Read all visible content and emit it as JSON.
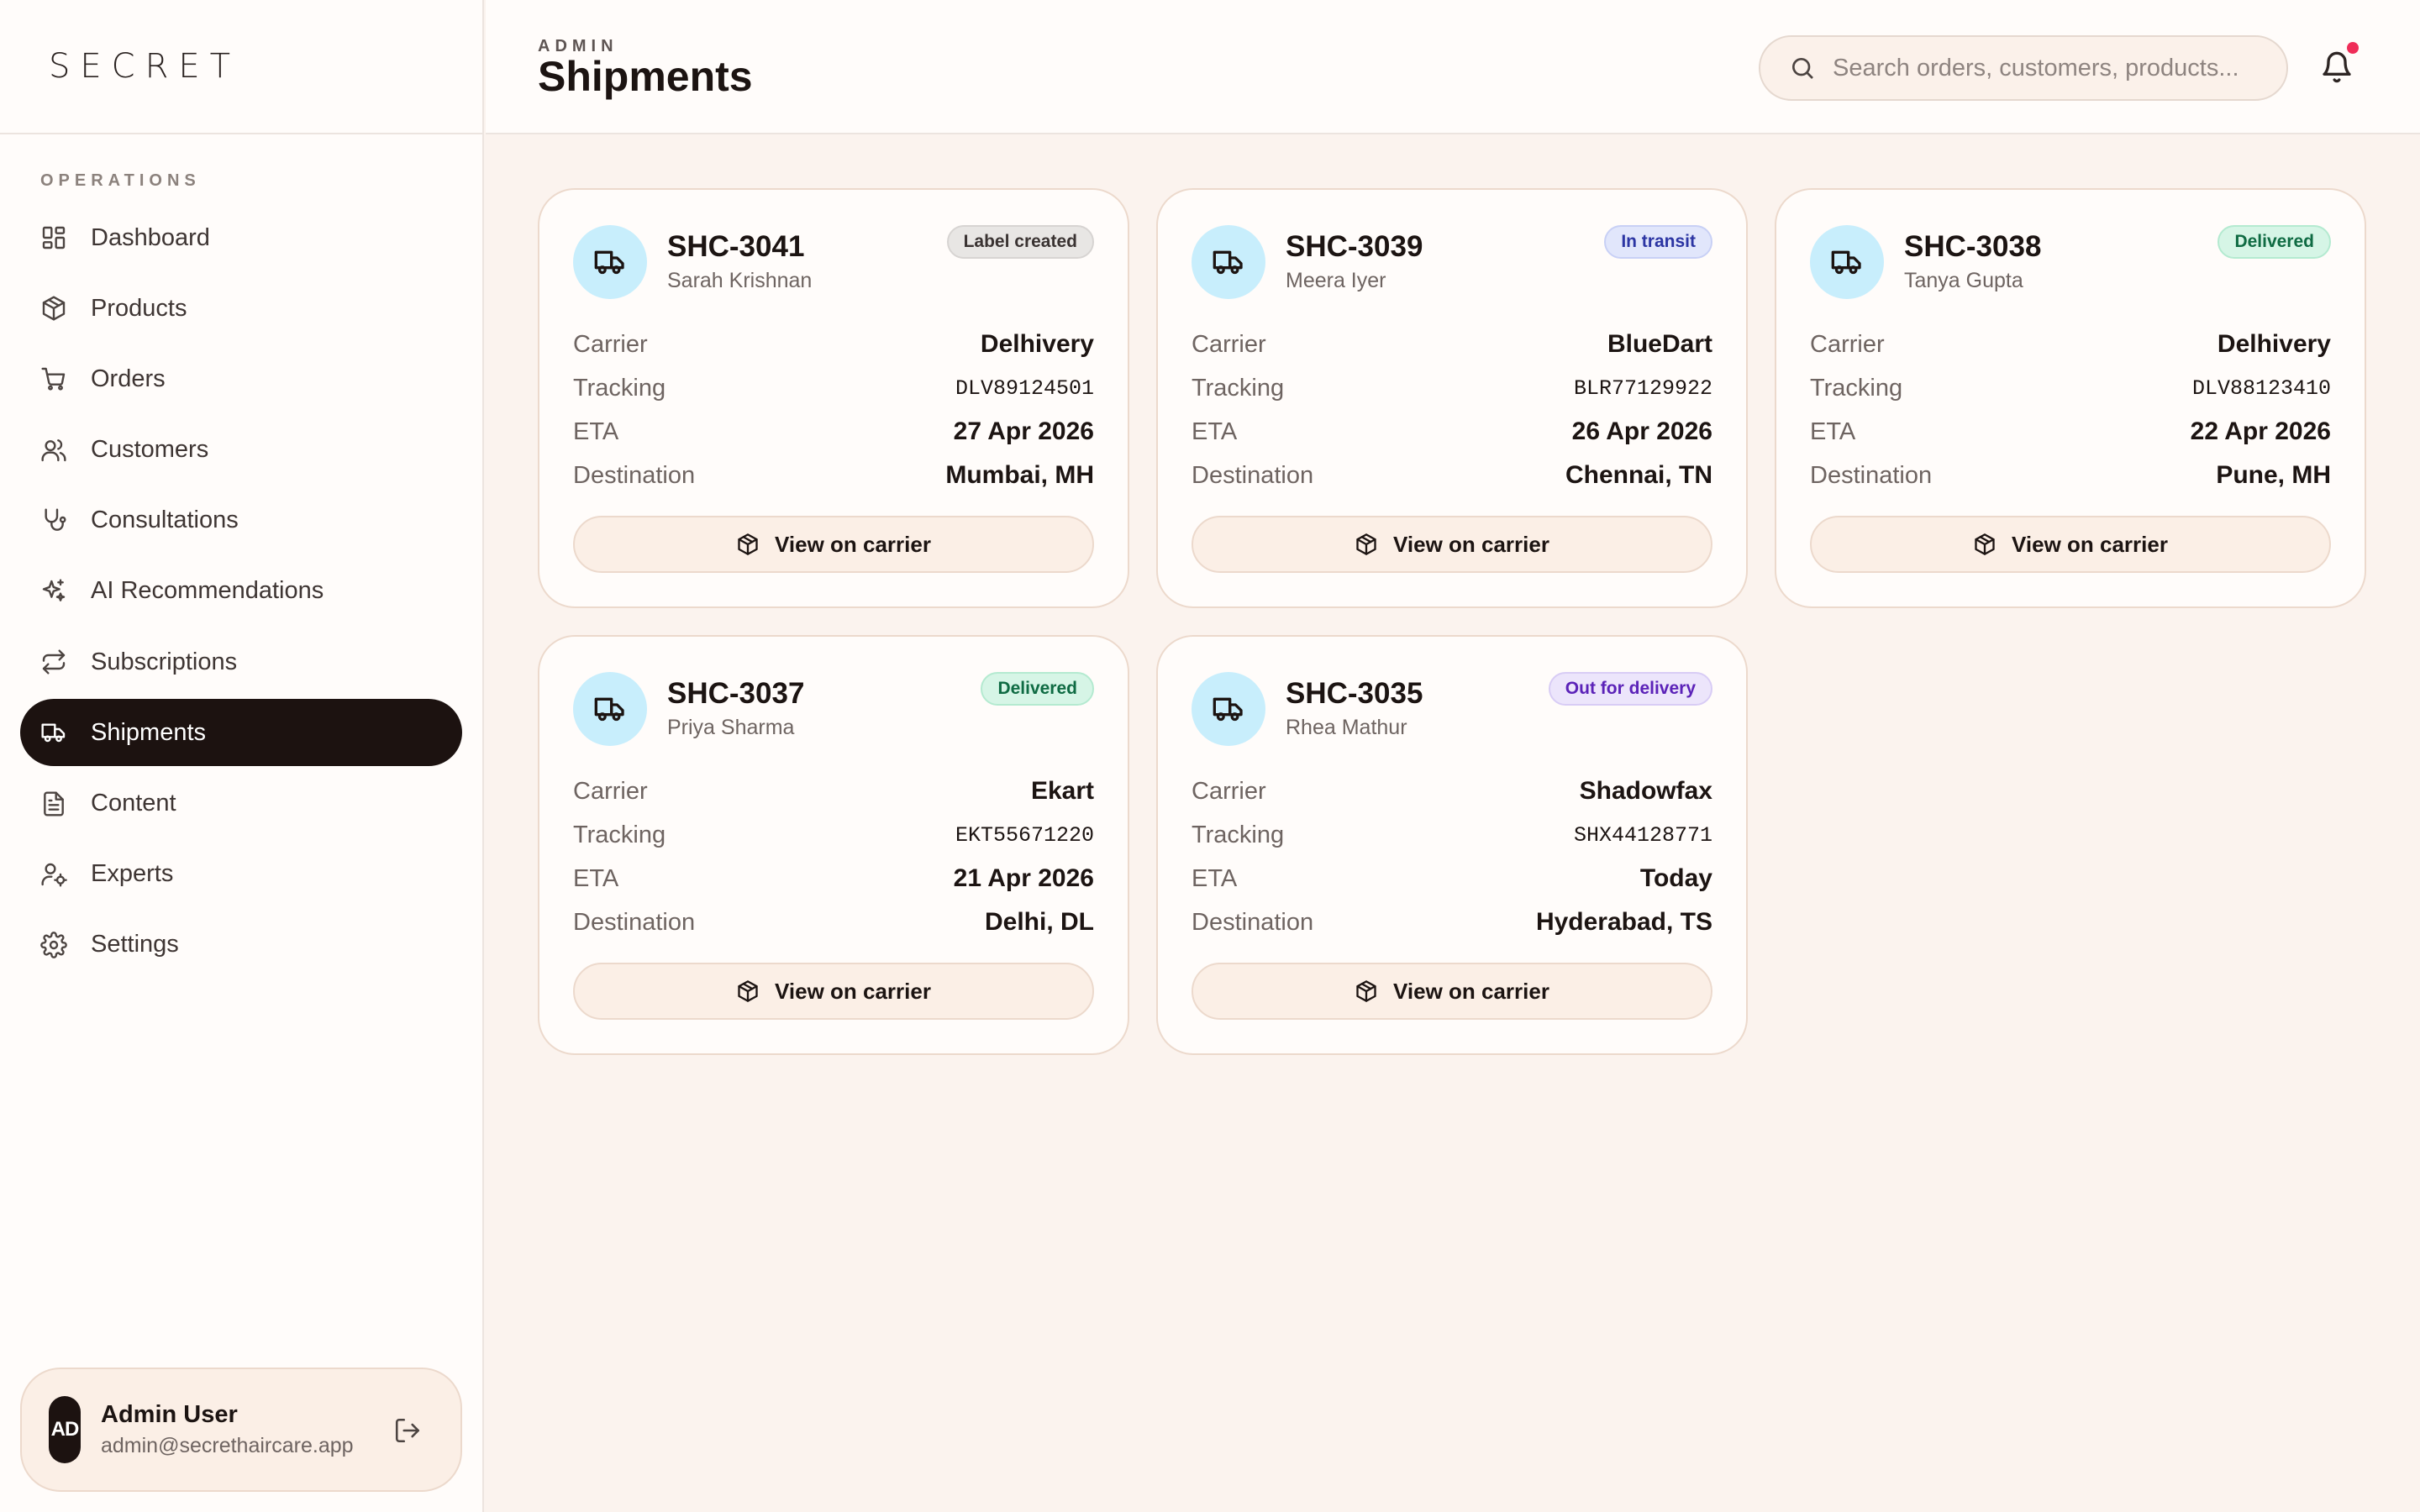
{
  "brand": {
    "logo_text": "SECRET"
  },
  "sidebar": {
    "section_label": "OPERATIONS",
    "items": [
      {
        "label": "Dashboard",
        "icon": "dashboard-icon"
      },
      {
        "label": "Products",
        "icon": "box-icon"
      },
      {
        "label": "Orders",
        "icon": "cart-icon"
      },
      {
        "label": "Customers",
        "icon": "users-icon"
      },
      {
        "label": "Consultations",
        "icon": "stethoscope-icon"
      },
      {
        "label": "AI Recommendations",
        "icon": "sparkles-icon"
      },
      {
        "label": "Subscriptions",
        "icon": "repeat-icon"
      },
      {
        "label": "Shipments",
        "icon": "truck-icon",
        "active": true
      },
      {
        "label": "Content",
        "icon": "document-icon"
      },
      {
        "label": "Experts",
        "icon": "user-cog-icon"
      },
      {
        "label": "Settings",
        "icon": "gear-icon"
      }
    ],
    "user": {
      "initials": "AD",
      "name": "Admin User",
      "email": "admin@secrethaircare.app"
    }
  },
  "header": {
    "eyebrow": "ADMIN",
    "title": "Shipments",
    "search_placeholder": "Search orders, customers, products..."
  },
  "labels": {
    "carrier": "Carrier",
    "tracking": "Tracking",
    "eta": "ETA",
    "destination": "Destination",
    "view_button": "View on carrier"
  },
  "shipments": [
    {
      "id": "SHC-3041",
      "customer": "Sarah Krishnan",
      "status": "Label created",
      "status_color": "gray",
      "carrier": "Delhivery",
      "tracking": "DLV89124501",
      "eta": "27 Apr 2026",
      "destination": "Mumbai, MH"
    },
    {
      "id": "SHC-3039",
      "customer": "Meera Iyer",
      "status": "In transit",
      "status_color": "blue",
      "carrier": "BlueDart",
      "tracking": "BLR77129922",
      "eta": "26 Apr 2026",
      "destination": "Chennai, TN"
    },
    {
      "id": "SHC-3038",
      "customer": "Tanya Gupta",
      "status": "Delivered",
      "status_color": "green",
      "carrier": "Delhivery",
      "tracking": "DLV88123410",
      "eta": "22 Apr 2026",
      "destination": "Pune, MH"
    },
    {
      "id": "SHC-3037",
      "customer": "Priya Sharma",
      "status": "Delivered",
      "status_color": "green",
      "carrier": "Ekart",
      "tracking": "EKT55671220",
      "eta": "21 Apr 2026",
      "destination": "Delhi, DL"
    },
    {
      "id": "SHC-3035",
      "customer": "Rhea Mathur",
      "status": "Out for delivery",
      "status_color": "purple",
      "carrier": "Shadowfax",
      "tracking": "SHX44128771",
      "eta": "Today",
      "destination": "Hyderabad, TS"
    }
  ]
}
